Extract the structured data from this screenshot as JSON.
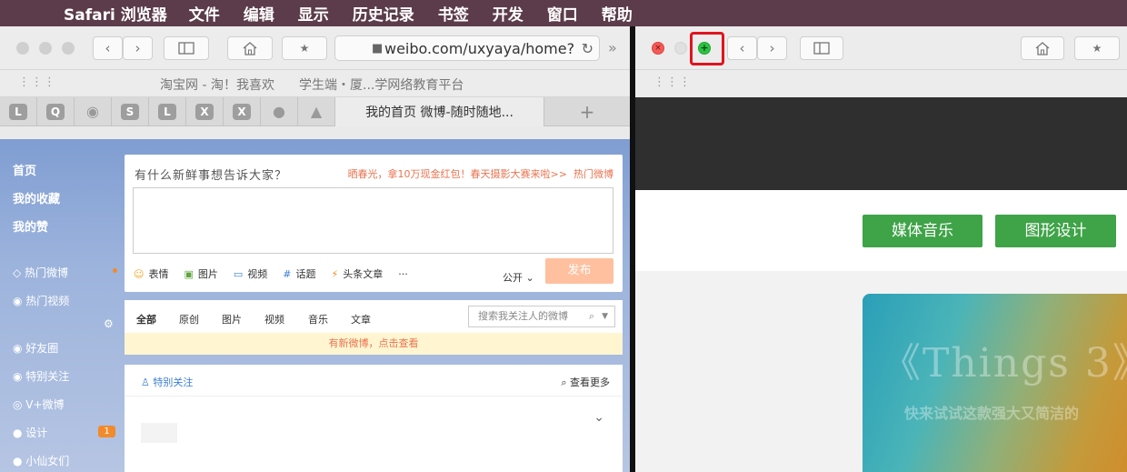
{
  "menubar": {
    "apple": "",
    "items": [
      "Safari 浏览器",
      "文件",
      "编辑",
      "显示",
      "历史记录",
      "书签",
      "开发",
      "窗口",
      "帮助"
    ]
  },
  "left_window": {
    "toolbar": {
      "back": "‹",
      "forward": "›",
      "sidebar_icon": "sidebar-icon",
      "home_icon": "home-icon",
      "bookmark_icon": "★",
      "url": "weibo.com/uxyaya/home?",
      "reload_icon": "↻",
      "overflow_icon": "»"
    },
    "favorites": [
      "淘宝网 - 淘！我喜欢",
      "学生端・厦...学网络教育平台"
    ],
    "tabs": {
      "icons": [
        "L",
        "Q",
        "wechat",
        "S",
        "L",
        "X",
        "X",
        "weibo",
        "qq"
      ],
      "active_title": "我的首页 微博-随时随地...",
      "new_tab": "+"
    },
    "weibo": {
      "sidebar": {
        "home": "首页",
        "favorites": "我的收藏",
        "likes": "我的赞",
        "hot_weibo": "热门微博",
        "hot_video": "热门视频",
        "friends": "好友圈",
        "special_follow": "特别关注",
        "vplus": "V+微博",
        "design": "设计",
        "design_badge": "1",
        "xiaoxian": "小仙女们"
      },
      "compose": {
        "prompt": "有什么新鲜事想告诉大家？",
        "promo": "晒春光，拿10万现金红包！春天摄影大赛来啦>>",
        "hot": "热门微博",
        "tools": [
          "表情",
          "图片",
          "视频",
          "话题",
          "头条文章",
          "···"
        ],
        "visibility": "公开",
        "send": "发布"
      },
      "feed_tabs": [
        "全部",
        "原创",
        "图片",
        "视频",
        "音乐",
        "文章"
      ],
      "search_placeholder": "搜索我关注人的微博",
      "notice": "有新微博，点击查看",
      "special": {
        "label": "特别关注",
        "more": "查看更多"
      }
    }
  },
  "right_window": {
    "toolbar": {
      "close": "×",
      "maximize": "+",
      "back": "‹",
      "forward": "›",
      "bookmark_icon": "★"
    },
    "buttons": [
      "媒体音乐",
      "图形设计"
    ],
    "card": {
      "title": "《Things 3》",
      "subtitle": "快来试试这款强大又简洁的"
    }
  }
}
